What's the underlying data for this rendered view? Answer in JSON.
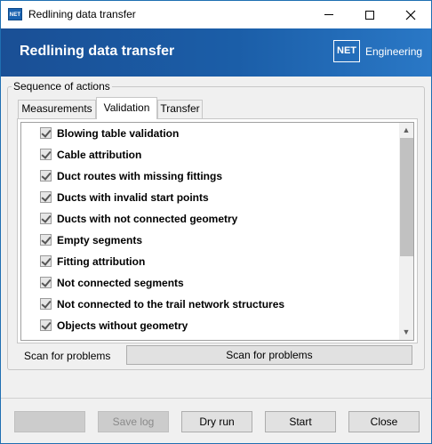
{
  "window": {
    "title": "Redlining data transfer",
    "app_icon_text": "NET"
  },
  "banner": {
    "title": "Redlining data transfer",
    "brand_box": "NET",
    "brand_text": "Engineering"
  },
  "group": {
    "legend": "Sequence of actions"
  },
  "tabs": [
    {
      "label": "Measurements",
      "selected": false
    },
    {
      "label": "Validation",
      "selected": true
    },
    {
      "label": "Transfer",
      "selected": false
    }
  ],
  "checks": [
    {
      "label": "Blowing table validation",
      "checked": true
    },
    {
      "label": "Cable attribution",
      "checked": true
    },
    {
      "label": "Duct routes with missing fittings",
      "checked": true
    },
    {
      "label": "Ducts with invalid start points",
      "checked": true
    },
    {
      "label": "Ducts with not connected geometry",
      "checked": true
    },
    {
      "label": "Empty segments",
      "checked": true
    },
    {
      "label": "Fitting attribution",
      "checked": true
    },
    {
      "label": "Not connected segments",
      "checked": true
    },
    {
      "label": "Not connected to the trail network structures",
      "checked": true
    },
    {
      "label": "Objects without geometry",
      "checked": true
    }
  ],
  "scan": {
    "label": "Scan for problems",
    "button": "Scan for problems"
  },
  "buttons": {
    "blank": "",
    "save_log": "Save log",
    "dry_run": "Dry run",
    "start": "Start",
    "close": "Close"
  },
  "colors": {
    "banner": "#1b5ea8",
    "window_bg": "#f0f0f0"
  }
}
